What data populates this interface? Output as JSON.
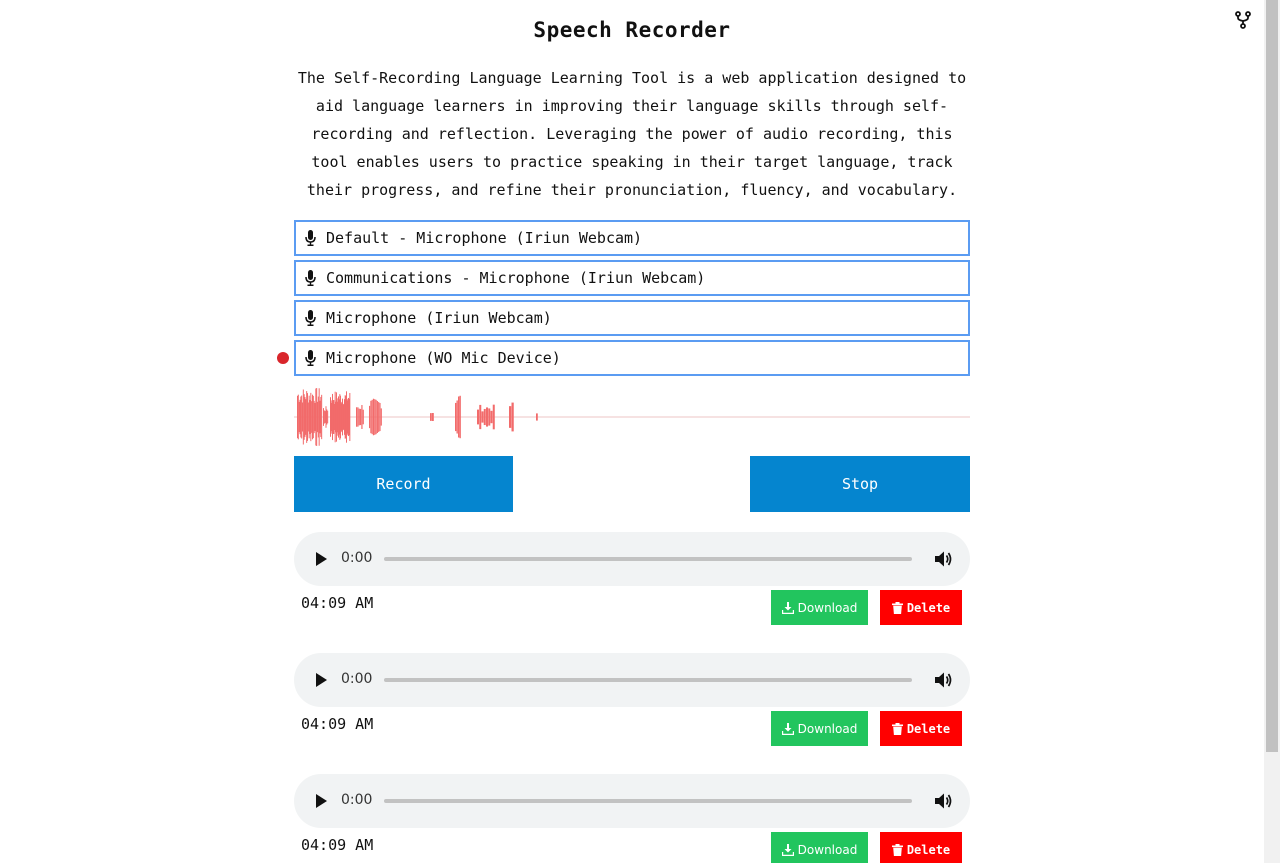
{
  "header": {
    "title": "Speech Recorder",
    "description": "The Self-Recording Language Learning Tool is a web application designed to aid language learners in improving their language skills through self-recording and reflection. Leveraging the power of audio recording, this tool enables users to practice speaking in their target language, track their progress, and refine their pronunciation, fluency, and vocabulary."
  },
  "devices": [
    {
      "label": "Default - Microphone (Iriun Webcam)",
      "active": false
    },
    {
      "label": "Communications - Microphone (Iriun Webcam)",
      "active": false
    },
    {
      "label": "Microphone (Iriun Webcam)",
      "active": false
    },
    {
      "label": "Microphone (WO Mic Device)",
      "active": true
    }
  ],
  "controls": {
    "record_label": "Record",
    "stop_label": "Stop"
  },
  "recordings": [
    {
      "current_time": "0:00",
      "timestamp": "04:09 AM",
      "download_label": "Download",
      "delete_label": "Delete"
    },
    {
      "current_time": "0:00",
      "timestamp": "04:09 AM",
      "download_label": "Download",
      "delete_label": "Delete"
    },
    {
      "current_time": "0:00",
      "timestamp": "04:09 AM",
      "download_label": "Download",
      "delete_label": "Delete"
    }
  ],
  "icons": {
    "top_right": "fork-icon",
    "device": "microphone-icon",
    "player_play": "play-icon",
    "player_volume": "volume-icon",
    "download": "download-icon",
    "delete": "trash-icon"
  },
  "colors": {
    "primary": "#0585cf",
    "device_border": "#5b9cf2",
    "recording_dot": "#d9252b",
    "waveform": "#f26b6b",
    "download": "#22c55e",
    "delete": "#ff0000"
  }
}
